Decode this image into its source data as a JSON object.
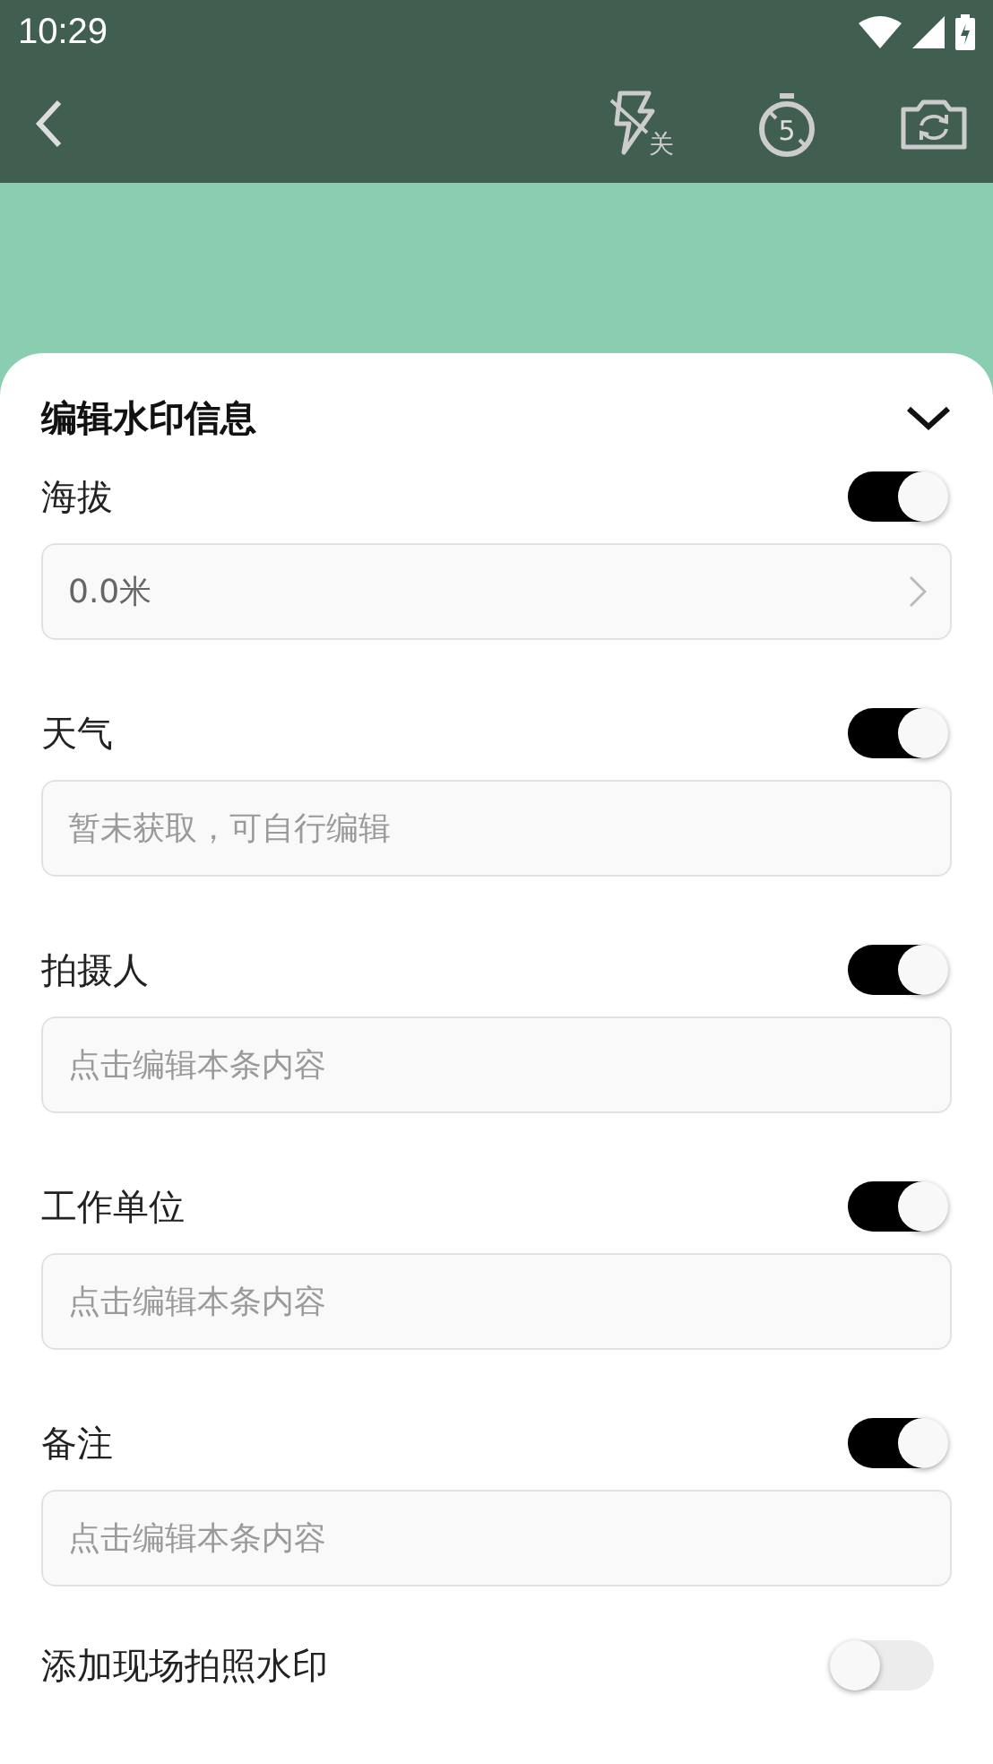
{
  "status_bar": {
    "time": "10:29"
  },
  "toolbar": {
    "flash_label": "关",
    "timer_label": "5"
  },
  "sheet": {
    "title": "编辑水印信息",
    "expanded": true,
    "items": [
      {
        "label": "海拔",
        "on": true,
        "kind": "select",
        "value": "0.0米"
      },
      {
        "label": "天气",
        "on": true,
        "kind": "text",
        "placeholder": "暂未获取，可自行编辑"
      },
      {
        "label": "拍摄人",
        "on": true,
        "kind": "text",
        "placeholder": "点击编辑本条内容"
      },
      {
        "label": "工作单位",
        "on": true,
        "kind": "text",
        "placeholder": "点击编辑本条内容"
      },
      {
        "label": "备注",
        "on": true,
        "kind": "text",
        "placeholder": "点击编辑本条内容"
      }
    ],
    "footer_toggle": {
      "label": "添加现场拍照水印",
      "on": false
    }
  }
}
